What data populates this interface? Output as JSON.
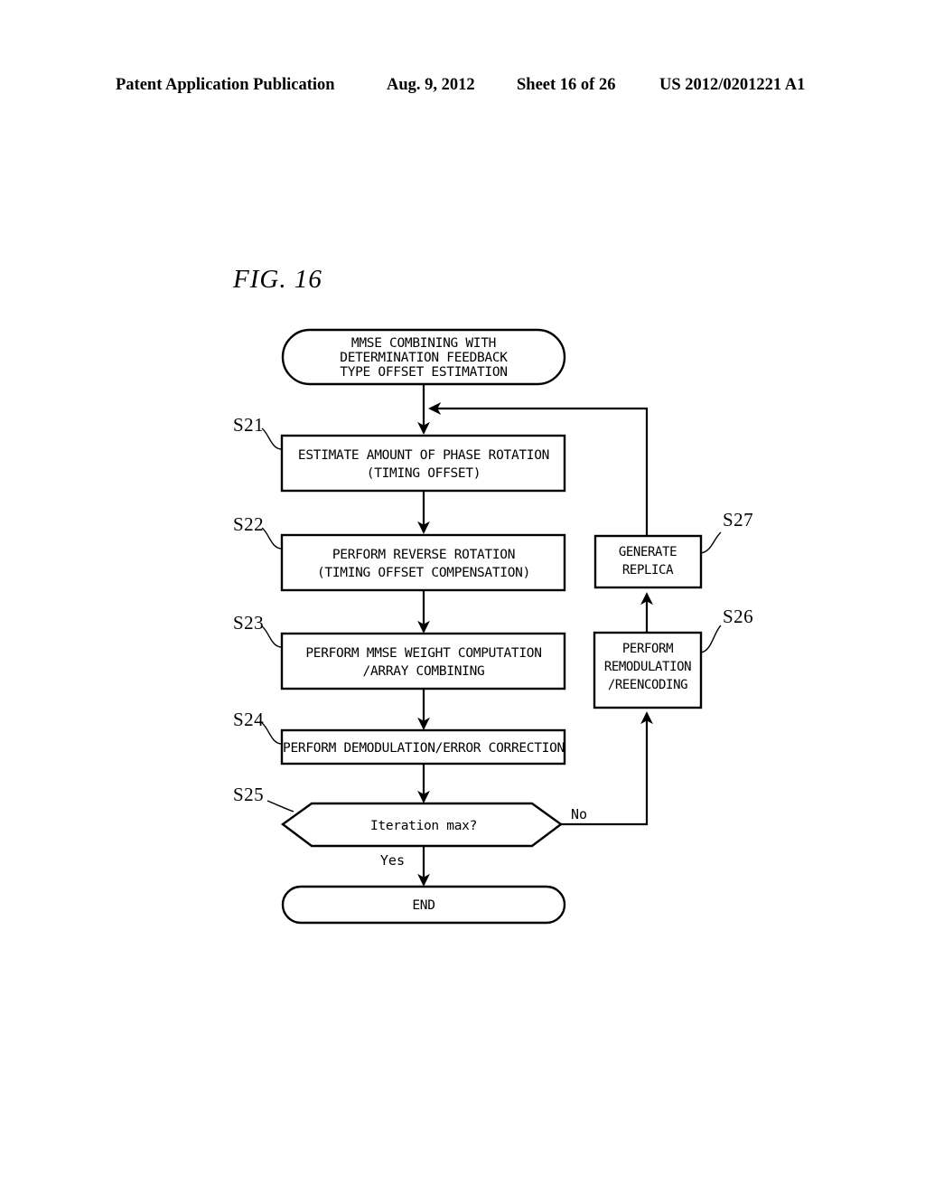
{
  "header": {
    "publication": "Patent Application Publication",
    "date": "Aug. 9, 2012",
    "sheet": "Sheet 16 of 26",
    "patent_number": "US 2012/0201221 A1"
  },
  "figure": {
    "label": "FIG. 16"
  },
  "chart_data": {
    "type": "diagram",
    "subtype": "flowchart",
    "title": "FIG. 16",
    "nodes": [
      {
        "id": "start",
        "shape": "terminator",
        "ref": "",
        "lines": [
          "MMSE COMBINING WITH",
          "DETERMINATION FEEDBACK",
          "TYPE OFFSET ESTIMATION"
        ]
      },
      {
        "id": "s21",
        "shape": "process",
        "ref": "S21",
        "lines": [
          "ESTIMATE AMOUNT OF PHASE ROTATION",
          "(TIMING OFFSET)"
        ]
      },
      {
        "id": "s22",
        "shape": "process",
        "ref": "S22",
        "lines": [
          "PERFORM REVERSE ROTATION",
          "(TIMING OFFSET COMPENSATION)"
        ]
      },
      {
        "id": "s23",
        "shape": "process",
        "ref": "S23",
        "lines": [
          "PERFORM MMSE WEIGHT COMPUTATION",
          "/ARRAY COMBINING"
        ]
      },
      {
        "id": "s24",
        "shape": "process",
        "ref": "S24",
        "lines": [
          "PERFORM DEMODULATION/ERROR CORRECTION"
        ]
      },
      {
        "id": "s25",
        "shape": "decision",
        "ref": "S25",
        "lines": [
          "Iteration max?"
        ]
      },
      {
        "id": "end",
        "shape": "terminator",
        "ref": "",
        "lines": [
          "END"
        ]
      },
      {
        "id": "s26",
        "shape": "process",
        "ref": "S26",
        "lines": [
          "PERFORM",
          "REMODULATION",
          "/REENCODING"
        ]
      },
      {
        "id": "s27",
        "shape": "process",
        "ref": "S27",
        "lines": [
          "GENERATE",
          "REPLICA"
        ]
      }
    ],
    "edges": [
      {
        "from": "start",
        "to": "s21",
        "label": ""
      },
      {
        "from": "s21",
        "to": "s22",
        "label": ""
      },
      {
        "from": "s22",
        "to": "s23",
        "label": ""
      },
      {
        "from": "s23",
        "to": "s24",
        "label": ""
      },
      {
        "from": "s24",
        "to": "s25",
        "label": ""
      },
      {
        "from": "s25",
        "to": "end",
        "label": "Yes"
      },
      {
        "from": "s25",
        "to": "s26",
        "label": "No"
      },
      {
        "from": "s26",
        "to": "s27",
        "label": ""
      },
      {
        "from": "s27",
        "to": "s21",
        "label": ""
      }
    ],
    "branch_labels": {
      "yes": "Yes",
      "no": "No"
    }
  },
  "nodes": {
    "start": {
      "l1": "MMSE COMBINING WITH",
      "l2": "DETERMINATION FEEDBACK",
      "l3": "TYPE OFFSET ESTIMATION"
    },
    "s21": {
      "ref": "S21",
      "l1": "ESTIMATE AMOUNT OF PHASE ROTATION",
      "l2": "(TIMING OFFSET)"
    },
    "s22": {
      "ref": "S22",
      "l1": "PERFORM REVERSE ROTATION",
      "l2": "(TIMING OFFSET COMPENSATION)"
    },
    "s23": {
      "ref": "S23",
      "l1": "PERFORM MMSE WEIGHT COMPUTATION",
      "l2": "/ARRAY COMBINING"
    },
    "s24": {
      "ref": "S24",
      "l1": "PERFORM DEMODULATION/ERROR CORRECTION"
    },
    "s25": {
      "ref": "S25",
      "l1": "Iteration max?"
    },
    "end": {
      "l1": "END"
    },
    "s26": {
      "ref": "S26",
      "l1": "PERFORM",
      "l2": "REMODULATION",
      "l3": "/REENCODING"
    },
    "s27": {
      "ref": "S27",
      "l1": "GENERATE",
      "l2": "REPLICA"
    }
  },
  "branches": {
    "yes": "Yes",
    "no": "No"
  },
  "colors": {
    "ink": "#000000",
    "paper": "#ffffff"
  }
}
